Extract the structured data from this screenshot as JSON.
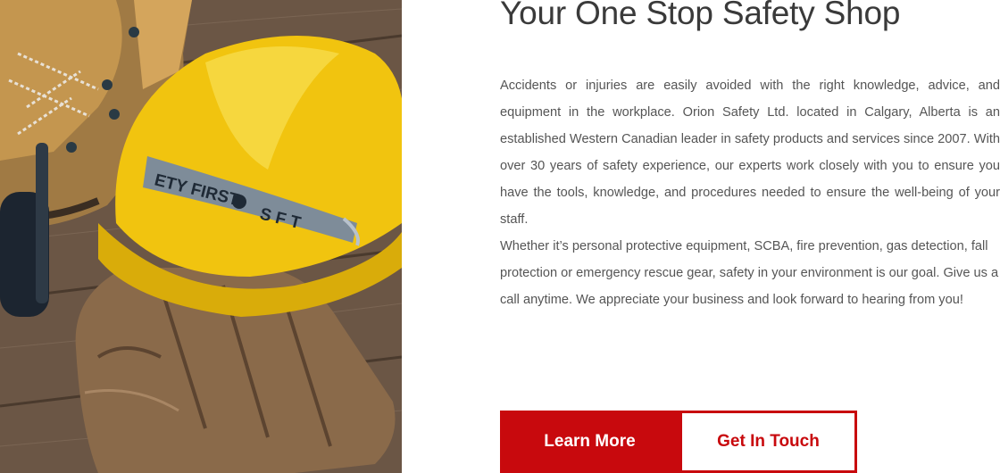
{
  "hero": {
    "image_alt": "Hard hat, work boots, earmuffs and leather gloves on wooden boards",
    "helmet_strap_text": "ETY FIRST",
    "helmet_strap_marks": "S F T"
  },
  "content": {
    "title": "Your One Stop Safety Shop",
    "paragraph_1": "Accidents or injuries are easily avoided with the right knowledge, advice, and equipment in the workplace. Orion Safety Ltd. located in Calgary, Alberta is an established Western Canadian leader in safety products and services since 2007. With over 30 years of safety experience, our experts work closely with you to ensure you have the tools, knowledge, and procedures needed to ensure the well-being of your staff.",
    "paragraph_2": "Whether it’s personal protective equipment, SCBA, fire prevention, gas detection, fall protection or emergency rescue gear, safety in your environment is our goal. Give us a call anytime. We appreciate your business and look forward to hearing from you!"
  },
  "actions": {
    "learn_more_label": "Learn More",
    "get_in_touch_label": "Get In Touch"
  },
  "colors": {
    "brand_red": "#c8090d",
    "title_text": "#3a3a3a",
    "body_text": "#555555"
  }
}
